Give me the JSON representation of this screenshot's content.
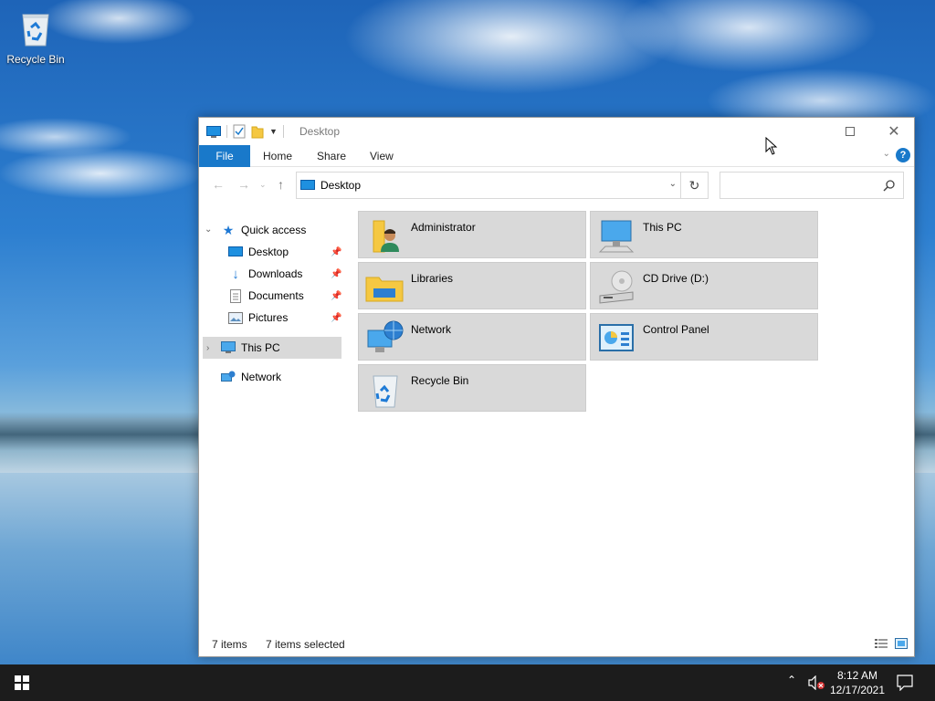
{
  "desktop": {
    "icons": [
      {
        "label": "Recycle Bin",
        "icon": "recycle-bin-icon"
      }
    ]
  },
  "window": {
    "title": "Desktop",
    "ribbon_tabs": [
      "File",
      "Home",
      "Share",
      "View"
    ],
    "address": "Desktop",
    "search_placeholder": "",
    "nav": {
      "quick_access": "Quick access",
      "quick_items": [
        "Desktop",
        "Downloads",
        "Documents",
        "Pictures"
      ],
      "this_pc": "This PC",
      "network": "Network"
    },
    "items": [
      {
        "label": "Administrator",
        "icon": "user-folder-icon"
      },
      {
        "label": "This PC",
        "icon": "computer-icon"
      },
      {
        "label": "Libraries",
        "icon": "libraries-icon"
      },
      {
        "label": "CD Drive (D:)",
        "icon": "cd-drive-icon"
      },
      {
        "label": "Network",
        "icon": "network-icon"
      },
      {
        "label": "Control Panel",
        "icon": "control-panel-icon"
      },
      {
        "label": "Recycle Bin",
        "icon": "recycle-bin-icon"
      }
    ],
    "status": {
      "count": "7 items",
      "selected": "7 items selected"
    }
  },
  "taskbar": {
    "time": "8:12 AM",
    "date": "12/17/2021"
  },
  "colors": {
    "accent": "#1979ca",
    "selection": "#d9d9d9",
    "taskbar": "#1c1c1c"
  }
}
